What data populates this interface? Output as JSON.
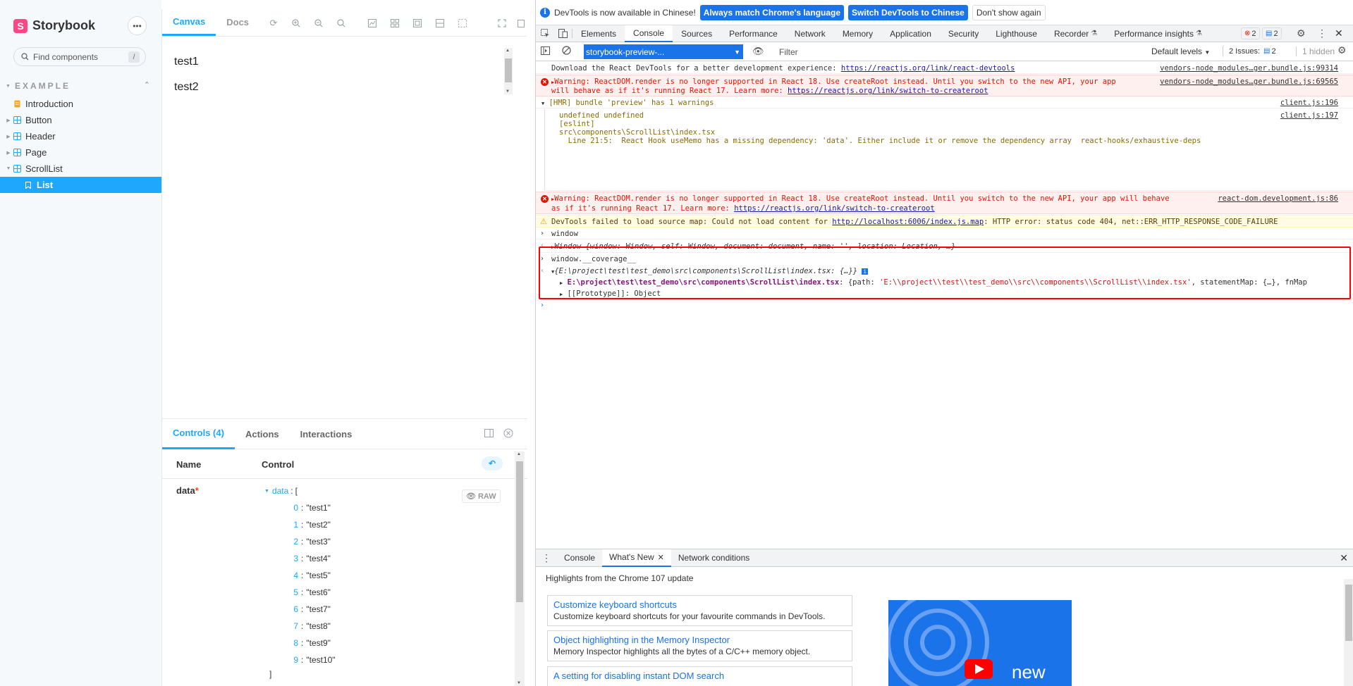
{
  "storybook": {
    "brand": "Storybook",
    "logo_letter": "S",
    "menu_icon": "ellipsis-icon",
    "search": {
      "placeholder": "Find components",
      "shortcut": "/"
    },
    "section_label": "EXAMPLE",
    "tree": [
      {
        "label": "Introduction",
        "icon": "document-icon",
        "has_caret": false
      },
      {
        "label": "Button",
        "icon": "component-icon",
        "has_caret": true
      },
      {
        "label": "Header",
        "icon": "component-icon",
        "has_caret": true
      },
      {
        "label": "Page",
        "icon": "component-icon",
        "has_caret": true
      },
      {
        "label": "ScrollList",
        "icon": "component-icon",
        "has_caret": true,
        "expanded": true
      },
      {
        "label": "List",
        "icon": "bookmark-icon",
        "selected": true
      }
    ],
    "toolbar": {
      "tabs": [
        "Canvas",
        "Docs"
      ],
      "active_tab": "Canvas"
    },
    "story_items": [
      "test1",
      "test2"
    ],
    "addons": {
      "tabs": [
        "Controls (4)",
        "Actions",
        "Interactions"
      ],
      "active_tab": "Controls (4)",
      "header_name": "Name",
      "header_control": "Control",
      "control_name": "data",
      "required_mark": "*",
      "raw_label": "RAW",
      "json_root_key": "data",
      "json_open": "[",
      "json_close": "]",
      "json_items": [
        {
          "index": "0",
          "value": "\"test1\""
        },
        {
          "index": "1",
          "value": "\"test2\""
        },
        {
          "index": "2",
          "value": "\"test3\""
        },
        {
          "index": "3",
          "value": "\"test4\""
        },
        {
          "index": "4",
          "value": "\"test5\""
        },
        {
          "index": "5",
          "value": "\"test6\""
        },
        {
          "index": "6",
          "value": "\"test7\""
        },
        {
          "index": "7",
          "value": "\"test8\""
        },
        {
          "index": "8",
          "value": "\"test9\""
        },
        {
          "index": "9",
          "value": "\"test10\""
        }
      ]
    }
  },
  "devtools": {
    "infobar": {
      "message": "DevTools is now available in Chinese!",
      "btn_match": "Always match Chrome's language",
      "btn_switch": "Switch DevTools to Chinese",
      "btn_dismiss": "Don't show again"
    },
    "tabs": [
      "Elements",
      "Console",
      "Sources",
      "Performance",
      "Network",
      "Memory",
      "Application",
      "Security",
      "Lighthouse",
      "Recorder",
      "Performance insights"
    ],
    "active_tab": "Console",
    "error_count": "2",
    "message_count": "2",
    "console_toolbar": {
      "context": "storybook-preview-...",
      "filter_placeholder": "Filter",
      "levels": "Default levels",
      "issues_label": "2 Issues:",
      "issues_count": "2",
      "hidden": "1 hidden"
    },
    "messages": {
      "m1_text": "Download the React DevTools for a better development experience: ",
      "m1_link": "https://reactjs.org/link/react-devtools",
      "m1_src": "vendors-node_modules…ger.bundle.js:99314",
      "m2_line1": "Warning: ReactDOM.render is no longer supported in React 18. Use createRoot instead. Until you switch to the new API, your app",
      "m2_line2": "will behave as if it's running React 17. Learn more: ",
      "m2_link": "https://reactjs.org/link/switch-to-createroot",
      "m2_src": "vendors-node_modules…ger.bundle.js:69565",
      "m3_group": "[HMR] bundle 'preview' has 1 warnings",
      "m3_src": "client.js:196",
      "m4_line1": "undefined undefined",
      "m4_line2": "[eslint]",
      "m4_line3": "src\\components\\ScrollList\\index.tsx",
      "m4_line4": "  Line 21:5:  React Hook useMemo has a missing dependency: 'data'. Either include it or remove the dependency array  react-hooks/exhaustive-deps",
      "m4_src": "client.js:197",
      "m5_line1": "Warning: ReactDOM.render is no longer supported in React 18. Use createRoot instead. Until you switch to the new API, your app will behave",
      "m5_line2": "as if it's running React 17. Learn more: ",
      "m5_link": "https://reactjs.org/link/switch-to-createroot",
      "m5_src": "react-dom.development.js:86",
      "m6_text": "DevTools failed to load source map: Could not load content for ",
      "m6_link": "http://localhost:6006/index.js.map",
      "m6_rest": ": HTTP error: status code 404, net::ERR_HTTP_RESPONSE_CODE_FAILURE",
      "m7_input": "window",
      "m8_output": "Window {window: Window, self: Window, document: document, name: '', location: Location, …}",
      "m9_input": "window.__coverage__",
      "m10_summary": "{E:\\project\\test\\test_demo\\src\\components\\ScrollList\\index.tsx: {…}}",
      "m11_key": "E:\\project\\test\\test_demo\\src\\components\\ScrollList\\index.tsx",
      "m11_val_pre": ": {path: ",
      "m11_val_str": "'E:\\\\project\\\\test\\\\test_demo\\\\src\\\\components\\\\ScrollList\\\\index.tsx'",
      "m11_val_post": ", statementMap: {…}, fnMap",
      "m12_proto": "[[Prototype]]: Object"
    },
    "drawer": {
      "tabs": [
        "Console",
        "What's New",
        "Network conditions"
      ],
      "active_tab": "What's New",
      "heading": "Highlights from the Chrome 107 update",
      "cards": [
        {
          "title": "Customize keyboard shortcuts",
          "desc": "Customize keyboard shortcuts for your favourite commands in DevTools."
        },
        {
          "title": "Object highlighting in the Memory Inspector",
          "desc": "Memory Inspector highlights all the bytes of a C/C++ memory object."
        },
        {
          "title": "A setting for disabling instant DOM search",
          "desc": ""
        }
      ],
      "video_caption": "new"
    }
  },
  "colors": {
    "storybook_accent": "#1ea7fd",
    "storybook_brand": "#ff4785",
    "devtools_blue": "#1a73e8",
    "error_red": "#e51400",
    "highlight_box": "#ff0000"
  }
}
